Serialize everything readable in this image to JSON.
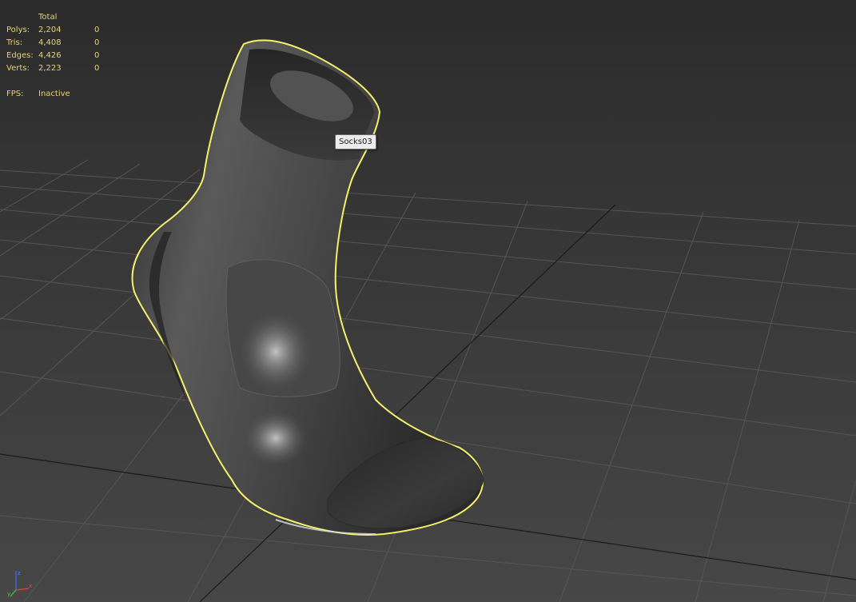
{
  "stats": {
    "header": "Total",
    "rows": [
      {
        "label": "Polys:",
        "total": "2,204",
        "selected": "0"
      },
      {
        "label": "Tris:",
        "total": "4,408",
        "selected": "0"
      },
      {
        "label": "Edges:",
        "total": "4,426",
        "selected": "0"
      },
      {
        "label": "Verts:",
        "total": "2,223",
        "selected": "0"
      }
    ],
    "fps_label": "FPS:",
    "fps_value": "Inactive"
  },
  "object": {
    "name": "Socks03",
    "selection_color": "#f4f06a"
  },
  "colors": {
    "stats_text": "#e8d36a",
    "grid_line": "#545454",
    "grid_axis": "#111111"
  },
  "axis_gizmo": {
    "axes": [
      "x",
      "y",
      "z"
    ],
    "x_color": "#d04040",
    "y_color": "#40b040",
    "z_color": "#4060e0"
  }
}
